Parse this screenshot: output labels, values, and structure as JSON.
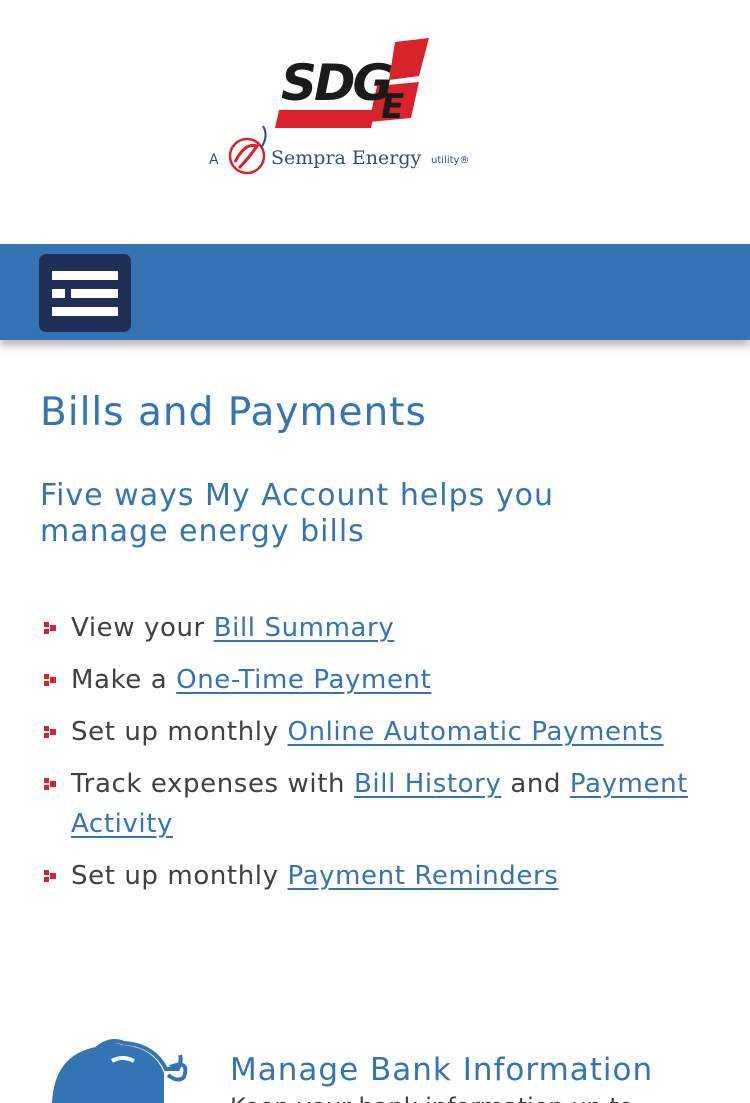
{
  "header": {
    "logo": {
      "wordmark": "SDGE",
      "tagline_prefix": "A",
      "tagline_brand": "Sempra Energy",
      "tagline_suffix": "utility®",
      "colors": {
        "black": "#1a1a1a",
        "red": "#d8232a",
        "blue": "#2d4b8e"
      }
    }
  },
  "navbar": {
    "color": "#3574b4",
    "menu_button_color": "#1f2f57",
    "menu_icon": "hamburger-list-icon"
  },
  "main": {
    "title": "Bills and Payments",
    "subtitle": "Five ways My Account helps you manage energy bills",
    "features": [
      {
        "prefix": "View your ",
        "link": "Bill Summary"
      },
      {
        "prefix": "Make a ",
        "link": "One-Time Payment "
      },
      {
        "prefix": "Set up monthly ",
        "link": "Online Automatic Payments"
      },
      {
        "prefix": "Track expenses with ",
        "link": "Bill History",
        "middle": " and ",
        "link2": "Payment Activity"
      },
      {
        "prefix": "Set up monthly ",
        "link": "Payment Reminders"
      }
    ],
    "bullet_color": "#d8232a",
    "link_color": "#3574b4"
  },
  "bank_section": {
    "icon": "piggy-bank-icon",
    "title": "Manage Bank Information",
    "description": "Keep your bank information up to"
  }
}
